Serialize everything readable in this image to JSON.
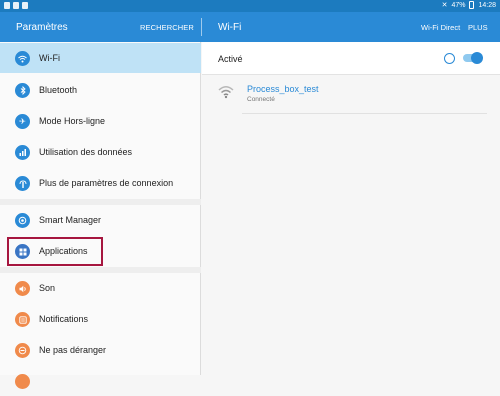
{
  "status_bar": {
    "time": "14:28",
    "battery": "47%"
  },
  "app_bar": {
    "left_title": "Paramètres",
    "search_label": "RECHERCHER",
    "right_title": "Wi-Fi",
    "wifi_direct_label": "Wi-Fi Direct",
    "plus_label": "PLUS"
  },
  "settings": {
    "groups": [
      [
        {
          "label": "Wi-Fi",
          "icon": "wifi-icon",
          "color": "#2a8ad6",
          "active": true
        },
        {
          "label": "Bluetooth",
          "icon": "bluetooth-icon",
          "color": "#2a8ad6"
        },
        {
          "label": "Mode Hors-ligne",
          "icon": "airplane-icon",
          "color": "#2a8ad6"
        },
        {
          "label": "Utilisation des données",
          "icon": "data-usage-icon",
          "color": "#2a8ad6"
        },
        {
          "label": "Plus de paramètres de connexion",
          "icon": "more-connections-icon",
          "color": "#2a8ad6"
        }
      ],
      [
        {
          "label": "Smart Manager",
          "icon": "smart-manager-icon",
          "color": "#2a8ad6"
        },
        {
          "label": "Applications",
          "icon": "apps-icon",
          "color": "#3a75c4",
          "highlighted": true
        }
      ],
      [
        {
          "label": "Son",
          "icon": "sound-icon",
          "color": "#f08a4b"
        },
        {
          "label": "Notifications",
          "icon": "notifications-icon",
          "color": "#f08a4b"
        },
        {
          "label": "Ne pas déranger",
          "icon": "do-not-disturb-icon",
          "color": "#f08a4b"
        }
      ]
    ]
  },
  "wifi_pane": {
    "activated_label": "Activé",
    "toggle_on": true,
    "networks": [
      {
        "name": "Process_box_test",
        "status": "Connecté"
      }
    ]
  },
  "colors": {
    "status_bar": "#1c7bbf",
    "app_bar": "#2a8ad6",
    "active_item": "#bfe2f6",
    "highlight_border": "#a6163f"
  }
}
